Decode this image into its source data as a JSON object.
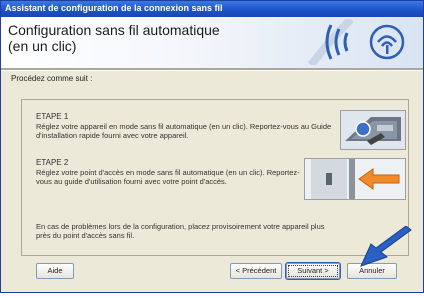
{
  "window": {
    "title": "Assistant de configuration de la connexion sans fil"
  },
  "header": {
    "title": "Configuration sans fil automatique\n(en un clic)"
  },
  "intro": "Procédez comme suit :",
  "steps": [
    {
      "title": "ETAPE 1",
      "text": "Réglez votre appareil en mode sans fil automatique (en un clic). Reportez-vous au Guide d'installation rapide fourni avec votre appareil."
    },
    {
      "title": "ETAPE 2",
      "text": "Réglez votre point d'accès en mode sans fil automatique (en un clic). Reportez-vous au guide d'utilisation fourni avec votre point d'accès."
    }
  ],
  "note": "En cas de problèmes lors de la configuration, placez provisoirement votre appareil plus près du point d'accès sans fil.",
  "buttons": {
    "help": "Aide",
    "back": "< Précédent",
    "next": "Suivant >",
    "cancel": "Annuler"
  },
  "icons": {
    "logo": "wireless-icon",
    "step1": "printer-panel-icon",
    "step2": "access-point-button-icon",
    "pointer": "blue-arrow-icon"
  },
  "colors": {
    "titlebar": "#1c52c8",
    "arrow": "#2a5fc4",
    "accent_arrow": "#f08a2a"
  }
}
